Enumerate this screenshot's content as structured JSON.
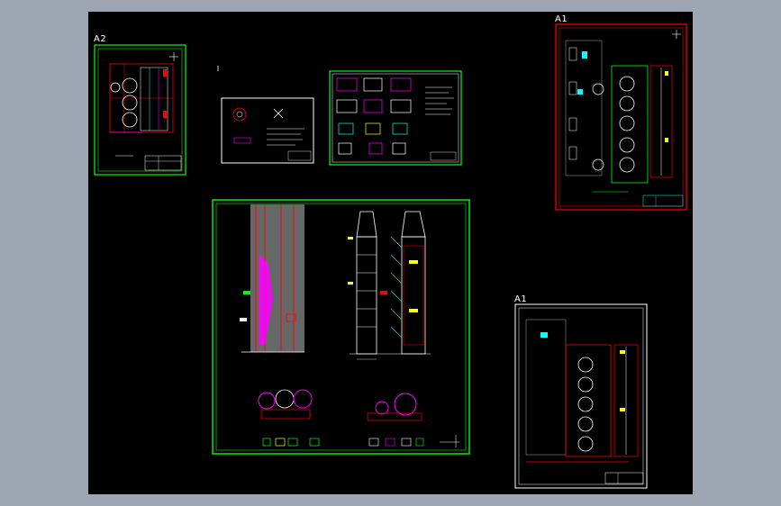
{
  "app": {
    "canvas_background": "#000000",
    "frame_background": "#9ea6b4"
  },
  "sheets": {
    "a2_label": "A2",
    "a1_top_label": "A1",
    "a1_bottom_label": "A1"
  },
  "colors": {
    "border_green": "#00ff00",
    "border_red": "#ff0000",
    "border_white": "#ffffff",
    "cyan": "#00ffff",
    "magenta": "#ff00ff",
    "yellow": "#ffff00",
    "gray_shade": "#8a8a8a"
  },
  "icons": {
    "ucs": "north-arrow-icon"
  }
}
